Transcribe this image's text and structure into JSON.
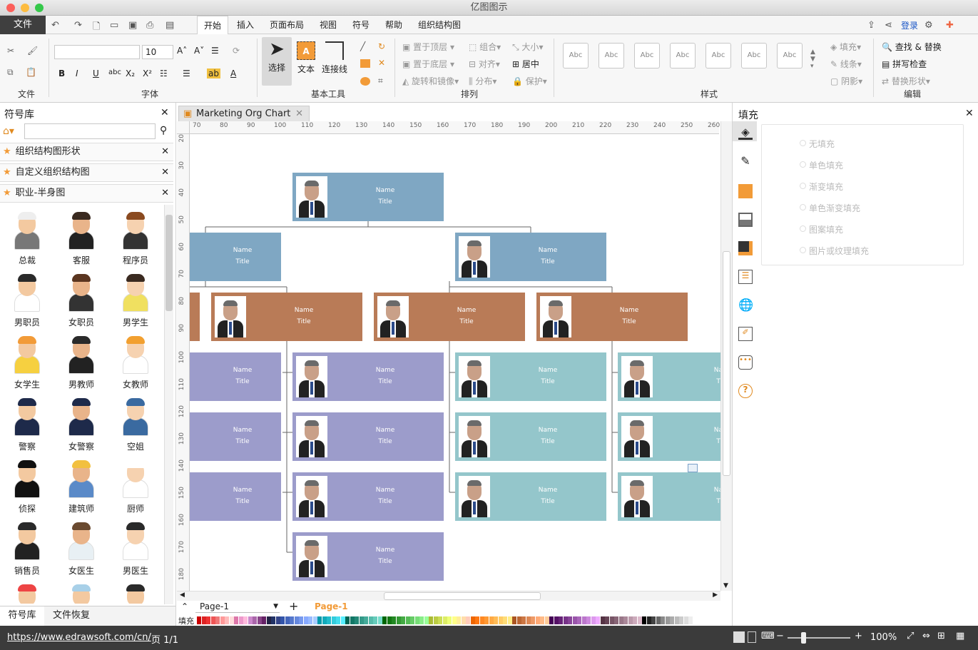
{
  "window": {
    "title": "亿图图示"
  },
  "menu": {
    "file": "文件",
    "tabs": [
      "开始",
      "插入",
      "页面布局",
      "视图",
      "符号",
      "帮助",
      "组织结构图"
    ],
    "login": "登录"
  },
  "ribbon": {
    "groups": {
      "file": "文件",
      "font": "字体",
      "basic_tools": "基本工具",
      "arrange": "排列",
      "style": "样式",
      "edit": "编辑"
    },
    "font_size": "10",
    "tools": {
      "select": "选择",
      "text": "文本",
      "connector": "连接线"
    },
    "arrange": {
      "top": "置于顶层",
      "bottom": "置于底层",
      "rotate": "旋转和镜像",
      "group": "组合",
      "align": "对齐",
      "distribute": "分布",
      "size": "大小",
      "center": "居中",
      "protect": "保护"
    },
    "style_box": "Abc",
    "format": {
      "fill": "填充",
      "line": "线条",
      "shadow": "阴影",
      "replace_shape": "替换形状"
    },
    "edit": {
      "find_replace": "查找 & 替换",
      "spell_check": "拼写检查"
    }
  },
  "library": {
    "title": "符号库",
    "categories": [
      "组织结构图形状",
      "自定义组织结构图",
      "职业-半身图"
    ],
    "symbols": [
      "总裁",
      "客服",
      "程序员",
      "男职员",
      "女职员",
      "男学生",
      "女学生",
      "男教师",
      "女教师",
      "警察",
      "女警察",
      "空姐",
      "侦探",
      "建筑师",
      "厨师",
      "销售员",
      "女医生",
      "男医生"
    ],
    "bottom_tabs": [
      "符号库",
      "文件恢复"
    ]
  },
  "document": {
    "tab": "Marketing Org Chart",
    "ruler_h": [
      "70",
      "80",
      "90",
      "100",
      "110",
      "120",
      "130",
      "140",
      "150",
      "160",
      "170",
      "180",
      "190",
      "200",
      "210",
      "220",
      "230",
      "240",
      "250",
      "260"
    ],
    "ruler_v": [
      "20",
      "30",
      "40",
      "50",
      "60",
      "70",
      "80",
      "90",
      "100",
      "110",
      "120",
      "130",
      "140",
      "150",
      "160",
      "170",
      "180"
    ],
    "node_name": "Name",
    "node_title": "Title",
    "colors": {
      "blue": "#7fa7c3",
      "brown": "#b97b57",
      "purple": "#9c9ccb",
      "teal": "#94c6cb"
    },
    "page_tab": "Page-1",
    "page_active": "Page-1",
    "fill_label": "填充"
  },
  "fill_panel": {
    "title": "填充",
    "options": [
      "无填充",
      "单色填充",
      "渐变填充",
      "单色渐变填充",
      "图案填充",
      "图片或纹理填充"
    ]
  },
  "status": {
    "url": "https://www.edrawsoft.com/cn/",
    "page": "页 1/1",
    "zoom": "100%"
  }
}
